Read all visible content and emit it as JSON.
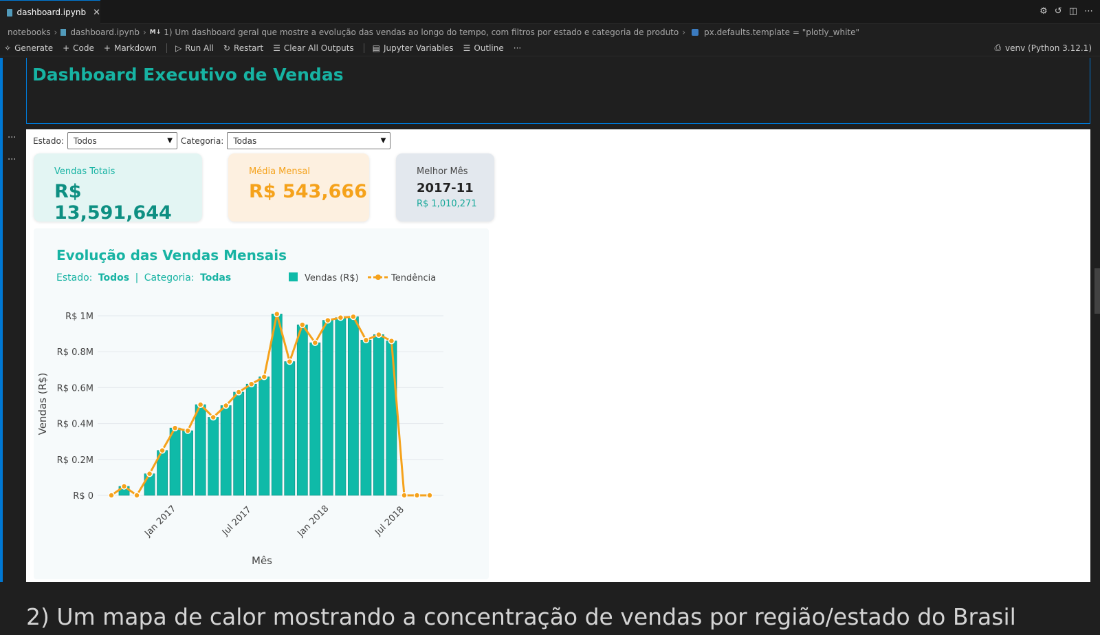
{
  "tab": {
    "title": "dashboard.ipynb",
    "close": "✕"
  },
  "breadcrumb": {
    "root": "notebooks",
    "file": "dashboard.ipynb",
    "md_badge": "M↓",
    "cell": "1) Um dashboard geral que mostre a evolução das vendas ao longo do tempo, com filtros por estado e categoria de produto",
    "symbol": "px.defaults.template = \"plotly_white\""
  },
  "toolbar": {
    "generate": "Generate",
    "code": "Code",
    "markdown": "Markdown",
    "run_all": "Run All",
    "restart": "Restart",
    "clear_outputs": "Clear All Outputs",
    "variables": "Jupyter Variables",
    "outline": "Outline",
    "more": "···",
    "kernel": "venv (Python 3.12.1)"
  },
  "markdown_cell": {
    "title": "Dashboard Executivo de Vendas"
  },
  "filters": {
    "estado_label": "Estado:",
    "estado_value": "Todos",
    "categoria_label": "Categoria:",
    "categoria_value": "Todas"
  },
  "kpis": {
    "vendas_totais": {
      "label": "Vendas Totais",
      "value": "R$ 13,591,644"
    },
    "media_mensal": {
      "label": "Média Mensal",
      "value": "R$ 543,666"
    },
    "melhor_mes": {
      "label": "Melhor Mês",
      "value": "2017-11",
      "sub": "R$ 1,010,271"
    }
  },
  "colors": {
    "teal": "#0fbaa8",
    "orange": "#f5a21b",
    "title_teal": "#17b3a3"
  },
  "chart_data": {
    "type": "bar",
    "title": "Evolução das Vendas Mensais",
    "subtitle_estado_label": "Estado:",
    "subtitle_estado_value": "Todos",
    "subtitle_sep": "|",
    "subtitle_categoria_label": "Categoria:",
    "subtitle_categoria_value": "Todas",
    "xlabel": "Mês",
    "ylabel": "Vendas (R$)",
    "ylim": [
      0,
      1050000
    ],
    "yticks": [
      0,
      200000,
      400000,
      600000,
      800000,
      1000000
    ],
    "ytick_labels": [
      "R$ 0",
      "R$ 0.2M",
      "R$ 0.4M",
      "R$ 0.6M",
      "R$ 0.8M",
      "R$ 1M"
    ],
    "xtick_labels": [
      "Jan 2017",
      "Jul 2017",
      "Jan 2018",
      "Jul 2018"
    ],
    "xtick_months": [
      "2017-01",
      "2017-07",
      "2018-01",
      "2018-07"
    ],
    "legend_position": "top-right",
    "months": [
      "2016-09",
      "2016-10",
      "2016-11",
      "2016-12",
      "2017-01",
      "2017-02",
      "2017-03",
      "2017-04",
      "2017-05",
      "2017-06",
      "2017-07",
      "2017-08",
      "2017-09",
      "2017-10",
      "2017-11",
      "2017-12",
      "2018-01",
      "2018-02",
      "2018-03",
      "2018-04",
      "2018-05",
      "2018-06",
      "2018-07",
      "2018-08",
      "2018-09",
      "2018-10"
    ],
    "series": [
      {
        "name": "Vendas (R$)",
        "kind": "bar",
        "values": [
          0,
          50000,
          0,
          120000,
          250000,
          375000,
          360000,
          505000,
          435000,
          500000,
          575000,
          620000,
          660000,
          1010271,
          745000,
          950000,
          850000,
          975000,
          990000,
          995000,
          865000,
          895000,
          860000,
          0,
          0,
          0
        ]
      },
      {
        "name": "Tendência",
        "kind": "line",
        "values": [
          0,
          50000,
          0,
          120000,
          250000,
          375000,
          360000,
          505000,
          435000,
          500000,
          575000,
          620000,
          660000,
          1010271,
          745000,
          950000,
          850000,
          975000,
          990000,
          995000,
          865000,
          895000,
          860000,
          0,
          0,
          0
        ]
      }
    ]
  },
  "next_section": {
    "heading": "2) Um mapa de calor mostrando a concentração de vendas por região/estado do Brasil"
  }
}
